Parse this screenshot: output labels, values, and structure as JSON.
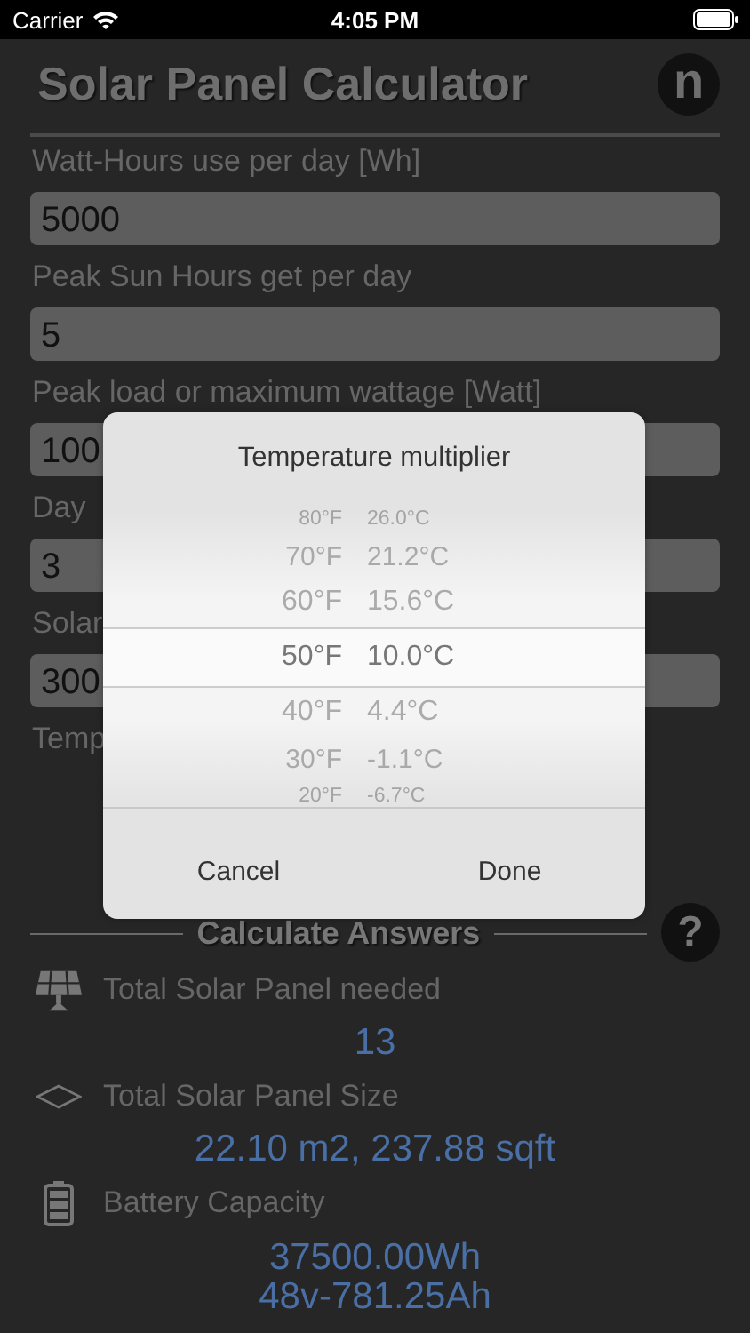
{
  "status_bar": {
    "carrier": "Carrier",
    "time": "4:05 PM"
  },
  "header": {
    "title": "Solar Panel Calculator",
    "logo": "n"
  },
  "inputs": [
    {
      "label": "Watt-Hours use per day [Wh]",
      "value": "5000"
    },
    {
      "label": "Peak Sun Hours get per day",
      "value": "5"
    },
    {
      "label": "Peak load or maximum wattage [Watt]",
      "value": "100"
    },
    {
      "label": "Day",
      "value": "3"
    },
    {
      "label": "Solar",
      "value": "300"
    }
  ],
  "temperature_label": "Temp",
  "dialog": {
    "title": "Temperature multiplier",
    "rows": [
      {
        "fahrenheit": "80°F",
        "celsius": "26.0°C",
        "selected": false
      },
      {
        "fahrenheit": "70°F",
        "celsius": "21.2°C",
        "selected": false
      },
      {
        "fahrenheit": "60°F",
        "celsius": "15.6°C",
        "selected": false
      },
      {
        "fahrenheit": "50°F",
        "celsius": "10.0°C",
        "selected": true
      },
      {
        "fahrenheit": "40°F",
        "celsius": "4.4°C",
        "selected": false
      },
      {
        "fahrenheit": "30°F",
        "celsius": "-1.1°C",
        "selected": false
      },
      {
        "fahrenheit": "20°F",
        "celsius": "-6.7°C",
        "selected": false
      }
    ],
    "buttons": [
      "Cancel",
      "Done"
    ]
  },
  "answers": {
    "heading": "Calculate Answers",
    "help": "?",
    "results": [
      {
        "kind": "solar-panel",
        "label": "Total Solar Panel needed",
        "values": [
          "13"
        ]
      },
      {
        "kind": "area",
        "label": "Total Solar Panel Size",
        "values": [
          "22.10 m2, 237.88 sqft"
        ]
      },
      {
        "kind": "battery",
        "label": "Battery Capacity",
        "values": [
          "37500.00Wh",
          "48v-781.25Ah"
        ]
      }
    ]
  }
}
